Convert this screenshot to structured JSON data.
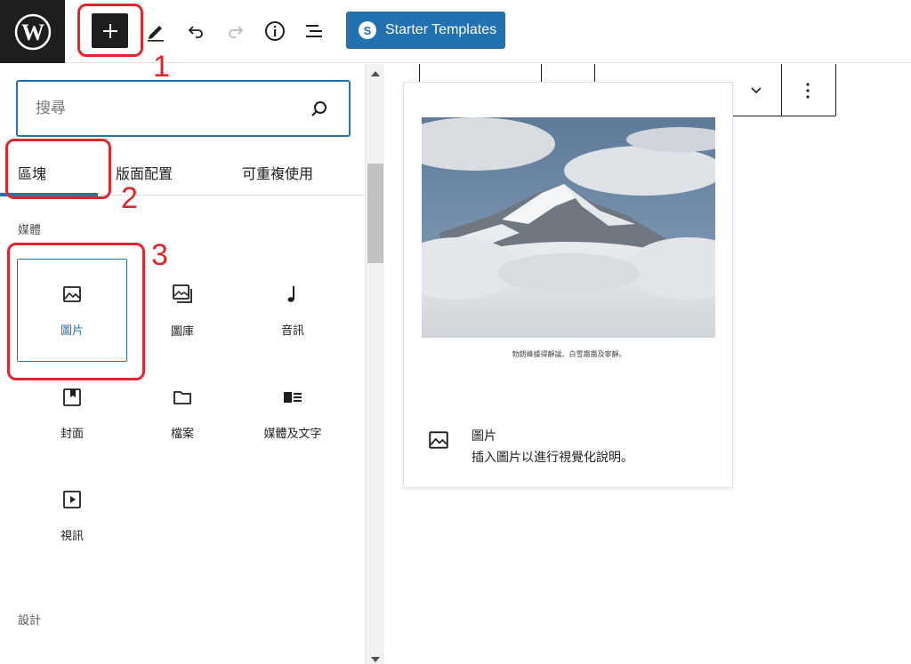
{
  "toolbar": {
    "inserter_label": "+",
    "starter_templates_label": "Starter Templates"
  },
  "annotations": {
    "step1": "1",
    "step2": "2",
    "step3": "3"
  },
  "inserter": {
    "search_placeholder": "搜尋",
    "tabs": [
      {
        "label": "區塊"
      },
      {
        "label": "版面配置"
      },
      {
        "label": "可重複使用"
      }
    ],
    "categories": {
      "media": "媒體",
      "design": "設計"
    },
    "blocks": [
      {
        "label": "圖片",
        "icon": "image-icon"
      },
      {
        "label": "圖庫",
        "icon": "gallery-icon"
      },
      {
        "label": "音訊",
        "icon": "audio-icon"
      },
      {
        "label": "封面",
        "icon": "cover-icon"
      },
      {
        "label": "檔案",
        "icon": "file-icon"
      },
      {
        "label": "媒體及文字",
        "icon": "media-text-icon"
      },
      {
        "label": "視訊",
        "icon": "video-icon"
      }
    ]
  },
  "preview": {
    "caption": "勃朗峰據得靜謐、白雪靄靄及寧靜。",
    "title": "圖片",
    "description": "插入圖片以進行視覺化說明。"
  },
  "colors": {
    "accent": "#2271b1",
    "annotation": "#e0262d",
    "dark": "#1e1e1e"
  }
}
